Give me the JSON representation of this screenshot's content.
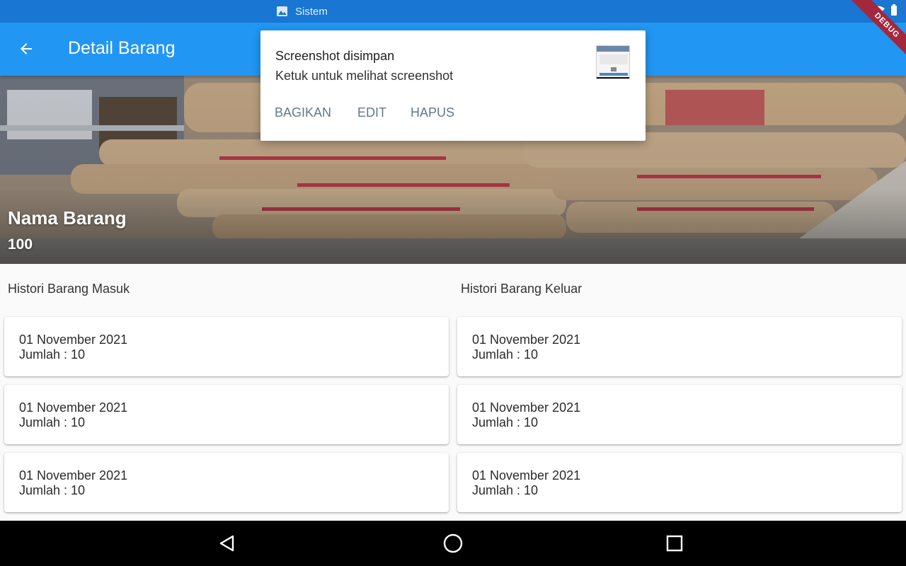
{
  "status_bar": {
    "notification_label": "Sistem",
    "notification_icon": "image-icon",
    "icons": [
      "wifi-icon",
      "battery-icon"
    ]
  },
  "app_bar": {
    "title": "Detail Barang",
    "back_icon": "arrow-back-icon",
    "background": "#2196f3"
  },
  "debug_banner": {
    "label": "DEBUG",
    "color": "#a4283d"
  },
  "hero": {
    "name": "Nama Barang",
    "quantity": "100",
    "image_description_icon": "product-photo"
  },
  "history_in": {
    "title": "Histori Barang Masuk",
    "items": [
      {
        "date": "01 November 2021",
        "amount": "Jumlah : 10"
      },
      {
        "date": "01 November 2021",
        "amount": "Jumlah : 10"
      },
      {
        "date": "01 November 2021",
        "amount": "Jumlah : 10"
      }
    ]
  },
  "history_out": {
    "title": "Histori Barang Keluar",
    "items": [
      {
        "date": "01 November 2021",
        "amount": "Jumlah : 10"
      },
      {
        "date": "01 November 2021",
        "amount": "Jumlah : 10"
      },
      {
        "date": "01 November 2021",
        "amount": "Jumlah : 10"
      }
    ]
  },
  "screenshot_notification": {
    "title": "Screenshot disimpan",
    "body": "Ketuk untuk melihat screenshot",
    "actions": [
      "BAGIKAN",
      "EDIT",
      "HAPUS"
    ],
    "action_color": "#5f7a8a"
  },
  "nav_bar": {
    "buttons": [
      "back-triangle-icon",
      "home-circle-icon",
      "recents-square-icon"
    ]
  }
}
